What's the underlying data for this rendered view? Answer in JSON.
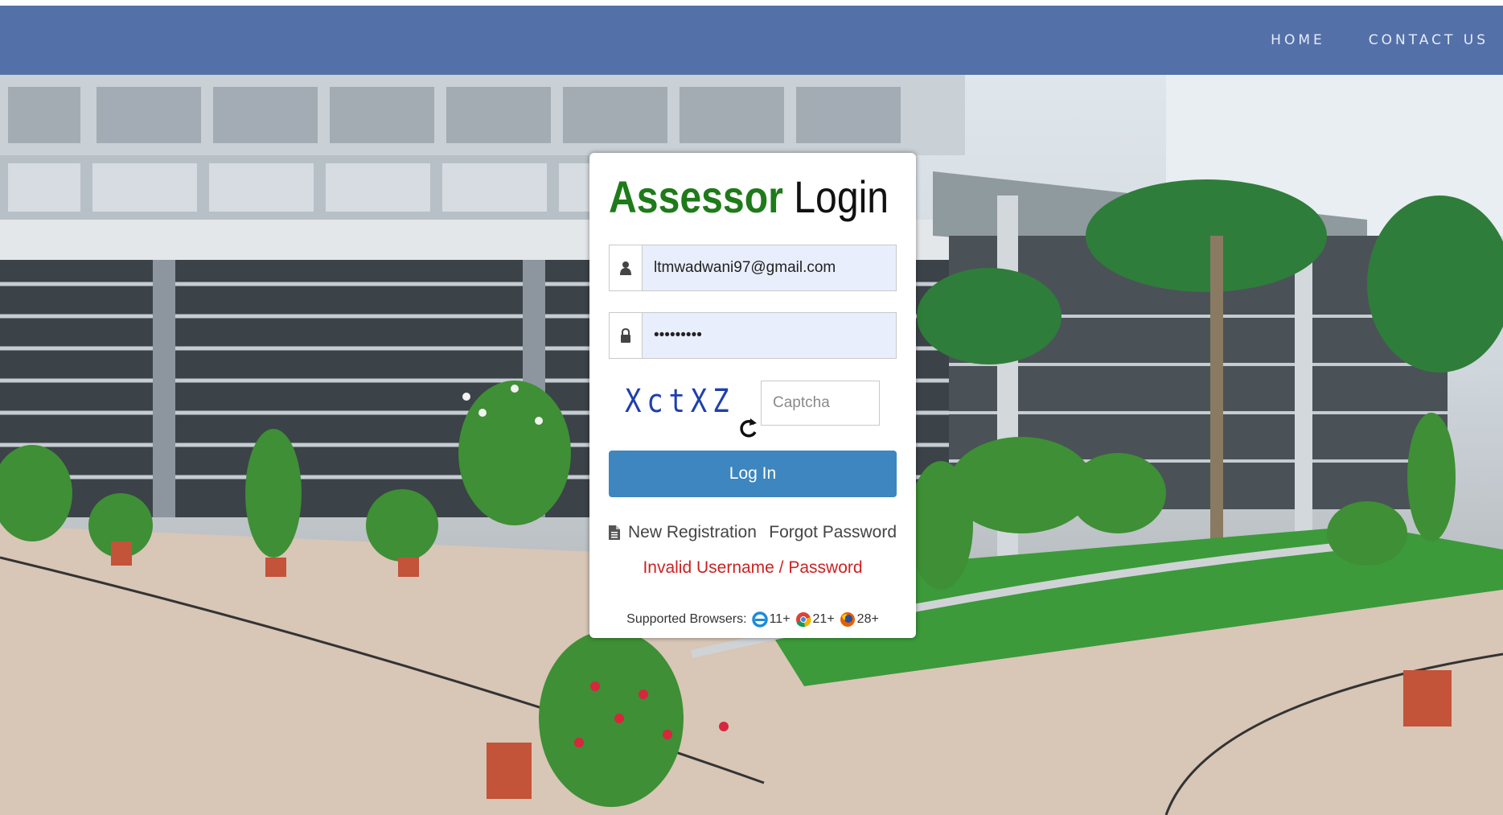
{
  "nav": {
    "links": [
      "HOME",
      "CONTACT US"
    ]
  },
  "login": {
    "title_accent": "Assessor",
    "title_rest": "Login",
    "username_value": "ltmwadwani97@gmail.com",
    "password_value": "•••••••••",
    "captcha_text": "XctXZ",
    "captcha_placeholder": "Captcha",
    "login_button": "Log In",
    "new_registration": "New Registration",
    "forgot_password": "Forgot Password",
    "error_message": "Invalid Username / Password",
    "supported_browsers_label": "Supported Browsers:",
    "browsers": [
      {
        "icon": "internet-explorer-icon",
        "version": "11+",
        "color": "#1e8bd6"
      },
      {
        "icon": "chrome-icon",
        "version": "21+",
        "color": "#db4437"
      },
      {
        "icon": "firefox-icon",
        "version": "28+",
        "color": "#e66000"
      }
    ]
  },
  "colors": {
    "navbar": "#5470a8",
    "title_accent": "#1f7a1a",
    "button": "#3d86bf",
    "error": "#cc2222",
    "captcha": "#1f3fae",
    "input_bg": "#e8eefc"
  },
  "icons": {
    "username": "user-icon",
    "password": "lock-icon",
    "refresh": "refresh-icon",
    "registration": "document-icon"
  }
}
